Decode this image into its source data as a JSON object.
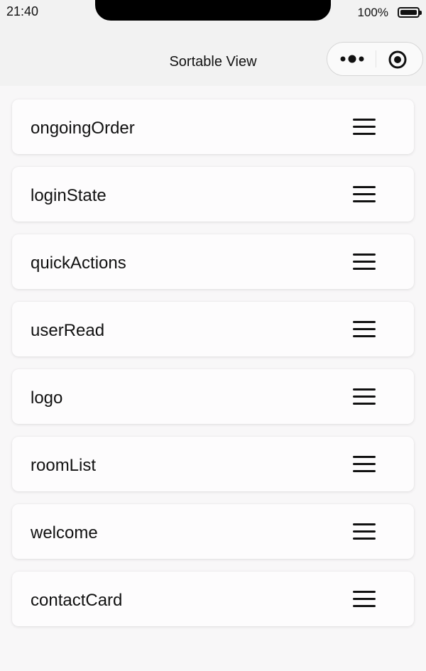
{
  "status_bar": {
    "time": "21:40",
    "battery_percent": "100%"
  },
  "nav": {
    "title": "Sortable View",
    "more_icon": "more-dots-icon",
    "close_icon": "target-close-icon"
  },
  "list": {
    "items": [
      {
        "label": "ongoingOrder"
      },
      {
        "label": "loginState"
      },
      {
        "label": "quickActions"
      },
      {
        "label": "userRead"
      },
      {
        "label": "logo"
      },
      {
        "label": "roomList"
      },
      {
        "label": "welcome"
      },
      {
        "label": "contactCard"
      }
    ],
    "handle_icon": "drag-handle-icon"
  }
}
